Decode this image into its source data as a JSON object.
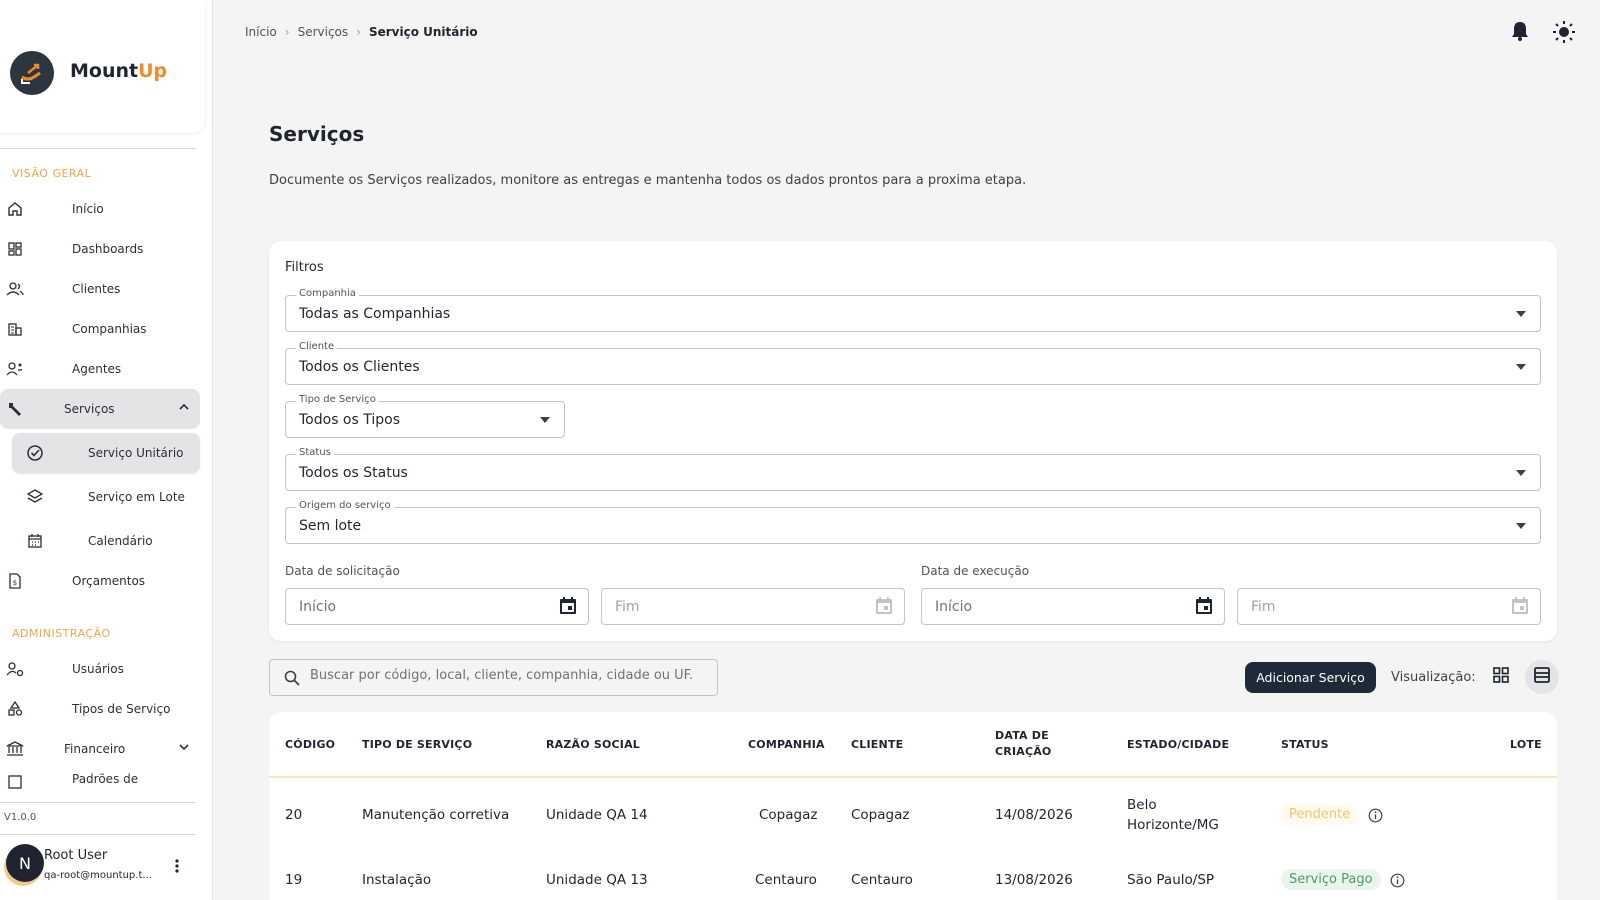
{
  "brand": {
    "name_a": "Mount",
    "name_b": "Up"
  },
  "sidebar": {
    "section_overview": "VISÃO GERAL",
    "section_admin": "ADMINISTRAÇÃO",
    "items": [
      {
        "label": "Início",
        "icon": "home-icon"
      },
      {
        "label": "Dashboards",
        "icon": "dashboard-icon"
      },
      {
        "label": "Clientes",
        "icon": "clients-icon"
      },
      {
        "label": "Companhias",
        "icon": "building-icon"
      },
      {
        "label": "Agentes",
        "icon": "agents-icon"
      },
      {
        "label": "Serviços",
        "icon": "wrench-icon"
      },
      {
        "label": "Serviço Unitário",
        "icon": "check-circle-icon"
      },
      {
        "label": "Serviço em Lote",
        "icon": "layers-icon"
      },
      {
        "label": "Calendário",
        "icon": "calendar-icon"
      },
      {
        "label": "Orçamentos",
        "icon": "budget-icon"
      },
      {
        "label": "Usuários",
        "icon": "users-gear-icon"
      },
      {
        "label": "Tipos de Serviço",
        "icon": "shapes-icon"
      },
      {
        "label": "Financeiro",
        "icon": "bank-icon"
      },
      {
        "label": "Padrões de",
        "icon": "standards-icon"
      }
    ],
    "version": "V1.0.0",
    "user": {
      "initial": "N",
      "name": "Root User",
      "email": "qa-root@mountup.t..."
    }
  },
  "breadcrumb": {
    "home": "Início",
    "section": "Serviços",
    "current": "Serviço Unitário"
  },
  "page": {
    "title": "Serviços",
    "description": "Documente os Serviços realizados, monitore as entregas e mantenha todos os dados prontos para a proxima etapa."
  },
  "filters": {
    "title": "Filtros",
    "company": {
      "label": "Companhia",
      "value": "Todas as Companhias"
    },
    "client": {
      "label": "Cliente",
      "value": "Todos os Clientes"
    },
    "service_type": {
      "label": "Tipo de Serviço",
      "value": "Todos os Tipos"
    },
    "status": {
      "label": "Status",
      "value": "Todos os Status"
    },
    "origin": {
      "label": "Origem do serviço",
      "value": "Sem lote"
    },
    "request_date": {
      "label": "Data de solicitação",
      "start": "Início",
      "end": "Fim"
    },
    "execution_date": {
      "label": "Data de execução",
      "start": "Início",
      "end": "Fim"
    }
  },
  "search": {
    "placeholder": "Buscar por código, local, cliente, companhia, cidade ou UF."
  },
  "toolbar": {
    "add_label": "Adicionar Serviço",
    "view_label": "Visualização:"
  },
  "table": {
    "headers": {
      "code": "CÓDIGO",
      "type": "TIPO DE SERVIÇO",
      "company_name": "RAZÃO SOCIAL",
      "company": "COMPANHIA",
      "client": "CLIENTE",
      "created_1": "DATA DE",
      "created_2": "CRIAÇÃO",
      "state_city": "ESTADO/CIDADE",
      "status": "STATUS",
      "batch": "LOTE"
    },
    "rows": [
      {
        "code": "20",
        "type": "Manutenção corretiva",
        "company_name": "Unidade QA 14",
        "company": "Copagaz",
        "client": "Copagaz",
        "created": "14/08/2026",
        "city_1": "Belo",
        "city_2": "Horizonte/MG",
        "status": "Pendente"
      },
      {
        "code": "19",
        "type": "Instalação",
        "company_name": "Unidade QA 13",
        "company": "Centauro",
        "client": "Centauro",
        "created": "13/08/2026",
        "city_1": "São Paulo/SP",
        "city_2": "",
        "status": "Serviço Pago"
      }
    ]
  },
  "colors": {
    "accent": "#f08a24",
    "primary_button": "#1f2a38",
    "pending": "#f2c66a",
    "paid": "#4a9b6e"
  }
}
